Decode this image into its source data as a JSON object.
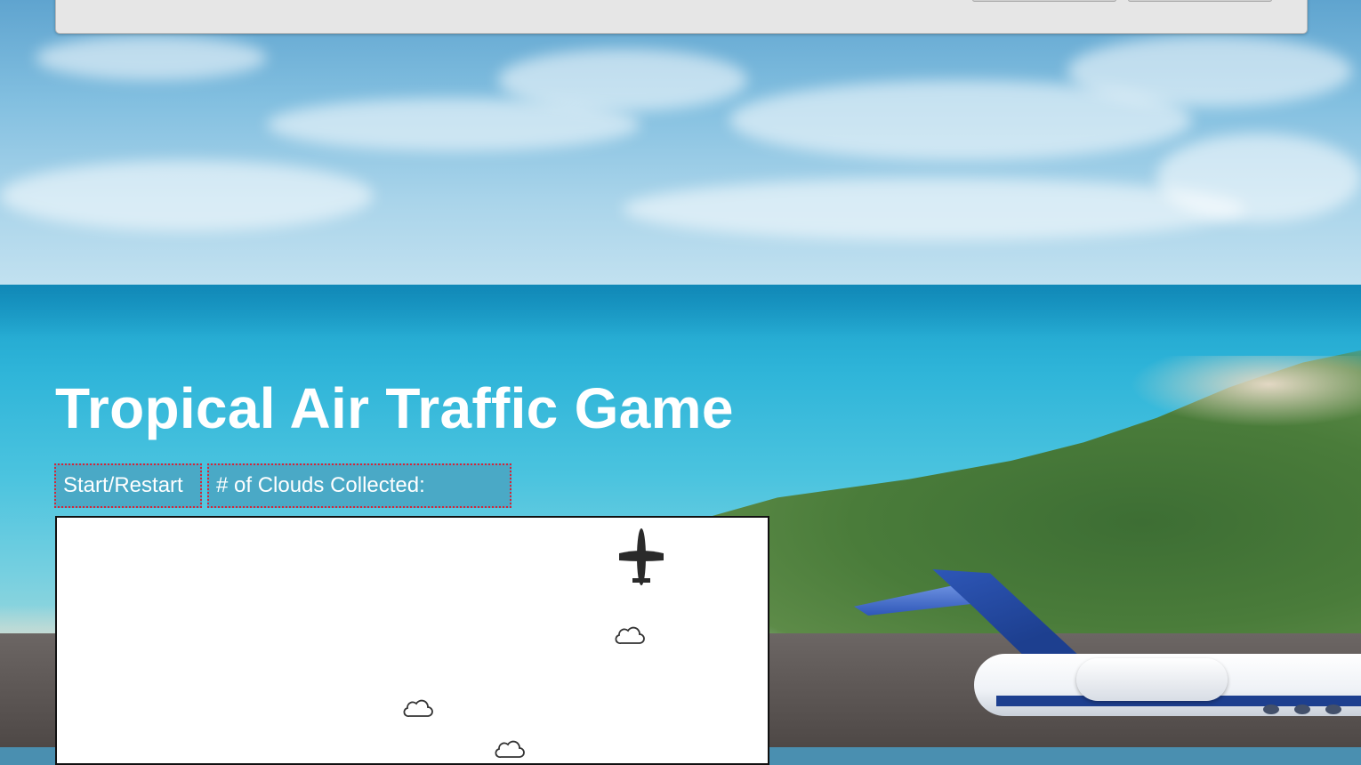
{
  "page": {
    "title": "Tropical Air Traffic Game",
    "start_button_label": "Start/Restart",
    "score_label": "# of Clouds Collected:",
    "score_value": ""
  },
  "sprites": {
    "player": "airplane-icon",
    "collectible": "cloud-icon"
  }
}
